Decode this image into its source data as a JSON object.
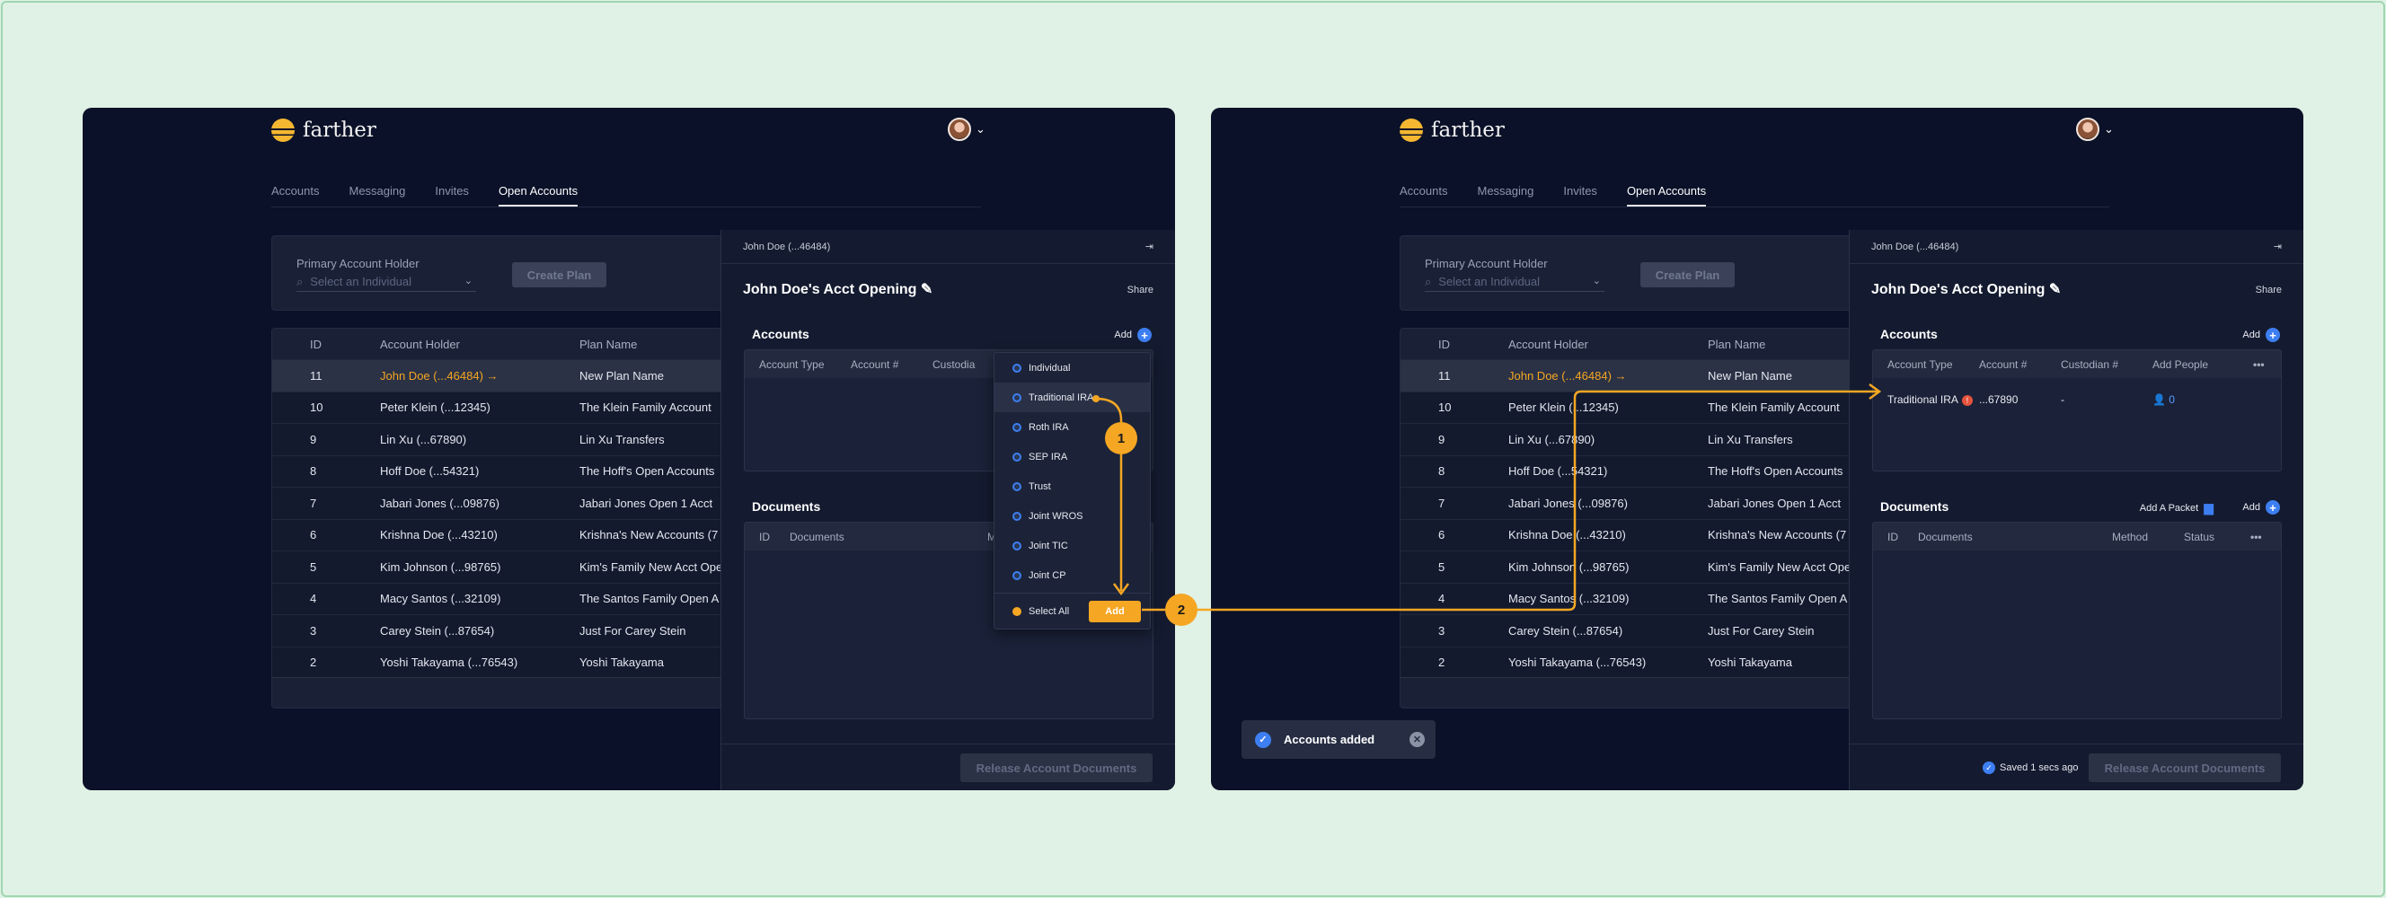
{
  "brand": {
    "name": "farther"
  },
  "tabs": [
    "Accounts",
    "Messaging",
    "Invites",
    "Open Accounts"
  ],
  "filter": {
    "label": "Primary Account Holder",
    "placeholder": "Select an Individual",
    "create_button": "Create Plan"
  },
  "table": {
    "headers": [
      "ID",
      "Account Holder",
      "Plan Name"
    ],
    "rows": [
      [
        "11",
        "John Doe (...46484) →",
        "New Plan Name"
      ],
      [
        "10",
        "Peter Klein (...12345)",
        "The Klein Family Account"
      ],
      [
        "9",
        "Lin Xu (...67890)",
        "Lin Xu Transfers"
      ],
      [
        "8",
        "Hoff Doe (...54321)",
        "The Hoff's Open Accounts"
      ],
      [
        "7",
        "Jabari Jones (...09876)",
        "Jabari Jones Open 1 Acct"
      ],
      [
        "6",
        "Krishna Doe (...43210)",
        "Krishna's New Accounts (7"
      ],
      [
        "5",
        "Kim Johnson (...98765)",
        "Kim's Family New Acct Ope"
      ],
      [
        "4",
        "Macy Santos (...32109)",
        "The Santos Family Open A"
      ],
      [
        "3",
        "Carey Stein (...87654)",
        "Just For Carey Stein"
      ],
      [
        "2",
        "Yoshi Takayama (...76543)",
        "Yoshi Takayama"
      ]
    ]
  },
  "panel": {
    "header": "John Doe (...46484)",
    "title": "John Doe's Acct Opening",
    "share": "Share",
    "accounts_title": "Accounts",
    "add": "Add",
    "add_packet": "Add A Packet",
    "documents_title": "Documents",
    "release": "Release Account Documents",
    "saved": "Saved 1 secs ago",
    "account_headers_before": [
      "Account Type",
      "Account #",
      "Custodia"
    ],
    "account_headers_after": [
      "Account Type",
      "Account #",
      "Custodian #",
      "Add People"
    ],
    "doc_headers_before": [
      "ID",
      "Documents",
      "Met"
    ],
    "doc_headers_after": [
      "ID",
      "Documents",
      "Method",
      "Status"
    ],
    "account_row": {
      "type": "Traditional IRA",
      "number": "...67890",
      "custodian": "-",
      "people": "0"
    }
  },
  "menu": {
    "items": [
      "Individual",
      "Traditional IRA",
      "Roth IRA",
      "SEP IRA",
      "Trust",
      "Joint WROS",
      "Joint TIC",
      "Joint CP"
    ],
    "select_all": "Select All",
    "add_button": "Add"
  },
  "steps": [
    "1",
    "2"
  ],
  "toast": {
    "text": "Accounts added"
  },
  "colors": {
    "accent": "#f5a623",
    "background": "#0a1128",
    "link": "#3d7ff2"
  }
}
